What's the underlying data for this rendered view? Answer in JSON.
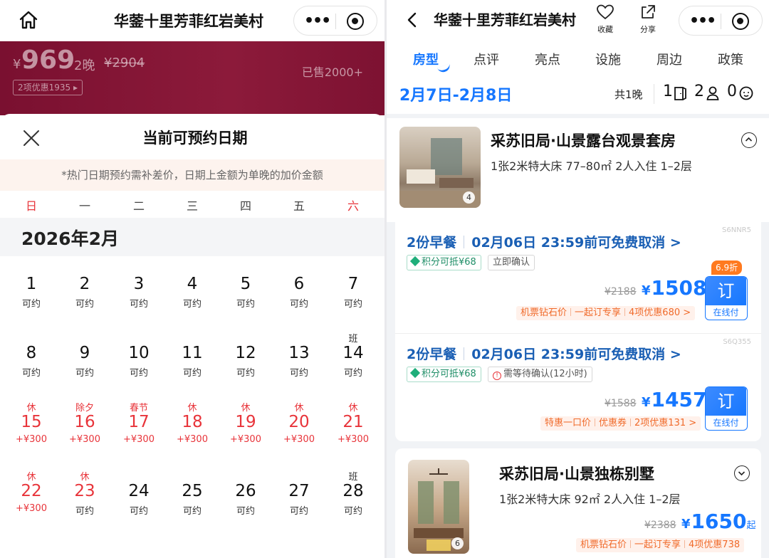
{
  "left": {
    "title": "华蓥十里芳菲红岩美村",
    "banner": {
      "currency": "¥",
      "price": "969",
      "nights": "2晚",
      "original_price": "¥2904",
      "sold": "已售2000+",
      "coupon": "2项优惠1935"
    },
    "sheet": {
      "title": "当前可预约日期",
      "notice": "*热门日期预约需补差价，日期上金额为单晚的加价金额",
      "weekdays": [
        "日",
        "一",
        "二",
        "三",
        "四",
        "五",
        "六"
      ],
      "month": "2026年2月",
      "days": [
        {
          "top": "",
          "num": "1",
          "sub": "可约"
        },
        {
          "top": "",
          "num": "2",
          "sub": "可约"
        },
        {
          "top": "",
          "num": "3",
          "sub": "可约"
        },
        {
          "top": "",
          "num": "4",
          "sub": "可约"
        },
        {
          "top": "",
          "num": "5",
          "sub": "可约"
        },
        {
          "top": "",
          "num": "6",
          "sub": "可约"
        },
        {
          "top": "",
          "num": "7",
          "sub": "可约"
        },
        {
          "top": "",
          "num": "8",
          "sub": "可约"
        },
        {
          "top": "",
          "num": "9",
          "sub": "可约"
        },
        {
          "top": "",
          "num": "10",
          "sub": "可约"
        },
        {
          "top": "",
          "num": "11",
          "sub": "可约"
        },
        {
          "top": "",
          "num": "12",
          "sub": "可约"
        },
        {
          "top": "",
          "num": "13",
          "sub": "可约"
        },
        {
          "top": "班",
          "num": "14",
          "sub": "可约"
        },
        {
          "top": "休",
          "num": "15",
          "sub": "+¥300"
        },
        {
          "top": "除夕",
          "num": "16",
          "sub": "+¥300"
        },
        {
          "top": "春节",
          "num": "17",
          "sub": "+¥300"
        },
        {
          "top": "休",
          "num": "18",
          "sub": "+¥300"
        },
        {
          "top": "休",
          "num": "19",
          "sub": "+¥300"
        },
        {
          "top": "休",
          "num": "20",
          "sub": "+¥300"
        },
        {
          "top": "休",
          "num": "21",
          "sub": "+¥300"
        },
        {
          "top": "休",
          "num": "22",
          "sub": "+¥300"
        },
        {
          "top": "休",
          "num": "23",
          "sub": "可约"
        },
        {
          "top": "",
          "num": "24",
          "sub": "可约"
        },
        {
          "top": "",
          "num": "25",
          "sub": "可约"
        },
        {
          "top": "",
          "num": "26",
          "sub": "可约"
        },
        {
          "top": "",
          "num": "27",
          "sub": "可约"
        },
        {
          "top": "班",
          "num": "28",
          "sub": "可约"
        }
      ]
    }
  },
  "right": {
    "title": "华蓥十里芳菲红岩美村",
    "favorite_label": "收藏",
    "share_label": "分享",
    "tabs": [
      "房型",
      "点评",
      "亮点",
      "设施",
      "周边",
      "政策"
    ],
    "date_range": "2月7日-2月8日",
    "nights": "共1晚",
    "rooms_count": "1",
    "adults_count": "2",
    "children_count": "0",
    "room1": {
      "name": "采苏旧局·山景露台观景套房",
      "meta": "1张2米特大床  77–80㎡  2人入住  1–2层",
      "photo_count": "4"
    },
    "rates": [
      {
        "code": "S6NNR5",
        "breakfast": "2份早餐",
        "cancel": "02月06日 23:59前可免费取消 >",
        "chip1": "积分可抵¥68",
        "chip2": "立即确认",
        "original_price": "¥2188",
        "currency": "¥",
        "price": "1508",
        "discount": "6.9折",
        "promo": [
          "机票钻石价",
          "一起订专享",
          "4项优惠680 >"
        ],
        "book": "订",
        "pay": "在线付"
      },
      {
        "code": "S6Q355",
        "breakfast": "2份早餐",
        "cancel": "02月06日 23:59前可免费取消 >",
        "chip1": "积分可抵¥68",
        "chip2": "需等待确认(12小时)",
        "original_price": "¥1588",
        "currency": "¥",
        "price": "1457",
        "promo": [
          "特惠一口价",
          "优惠券",
          "2项优惠131 >"
        ],
        "book": "订",
        "pay": "在线付"
      }
    ],
    "room2": {
      "name": "采苏旧局·山景独栋别墅",
      "meta": "1张2米特大床  92㎡  2人入住  1–2层",
      "photo_count": "6",
      "original_price": "¥2388",
      "currency": "¥",
      "price": "1650",
      "suffix": "起",
      "promo": [
        "机票钻石价",
        "一起订专享",
        "4项优惠738"
      ]
    }
  }
}
